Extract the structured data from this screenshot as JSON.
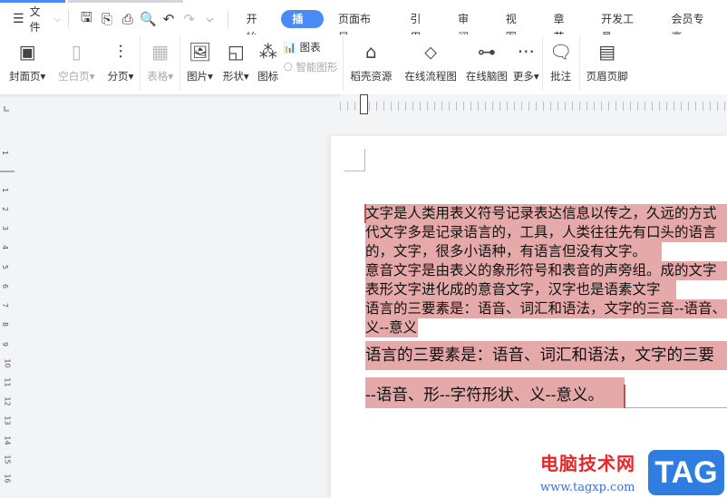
{
  "menu": {
    "file": "文件",
    "tabs": [
      "开始",
      "插入",
      "页面布局",
      "引用",
      "审阅",
      "视图",
      "章节",
      "开发工具",
      "会员专享"
    ],
    "active_tab": "插入"
  },
  "ribbon": {
    "cover": "封面页",
    "blank": "空白页",
    "pagebreak": "分页",
    "table": "表格",
    "picture": "图片",
    "shape": "形状",
    "icon": "图标",
    "chart": "图表",
    "smartart": "智能图形",
    "resources": "稻壳资源",
    "flowchart": "在线流程图",
    "mindmap": "在线脑图",
    "more": "更多",
    "comment": "批注",
    "header_footer": "页眉页脚"
  },
  "ruler": {
    "vertical": [
      "1",
      "1",
      "2",
      "3",
      "4",
      "5",
      "6",
      "7",
      "8",
      "9",
      "10",
      "11",
      "12",
      "13",
      "14",
      "15",
      "16"
    ]
  },
  "document": {
    "lines": [
      "文字是人类用表义符号记录表达信息以传之，久远的方式",
      "代文字多是记录语言的，工具，人类往往先有口头的语言",
      "的，文字，很多小语种，有语言但没有文字。",
      "意音文字是由表义的象形符号和表音的声旁组。成的文字",
      "表形文字进化成的意音文字，汉字也是语素文字",
      "语言的三要素是：语音、词汇和语法，文字的三音--语音、",
      "义--意义"
    ],
    "big_lines": [
      "语言的三要素是：语音、词汇和语法，文字的三要",
      "--语音、形--字符形状、义--意义。"
    ]
  },
  "watermark": {
    "site": "电脑技术网",
    "url": "www.tagxp.com",
    "tag": "TAG"
  }
}
